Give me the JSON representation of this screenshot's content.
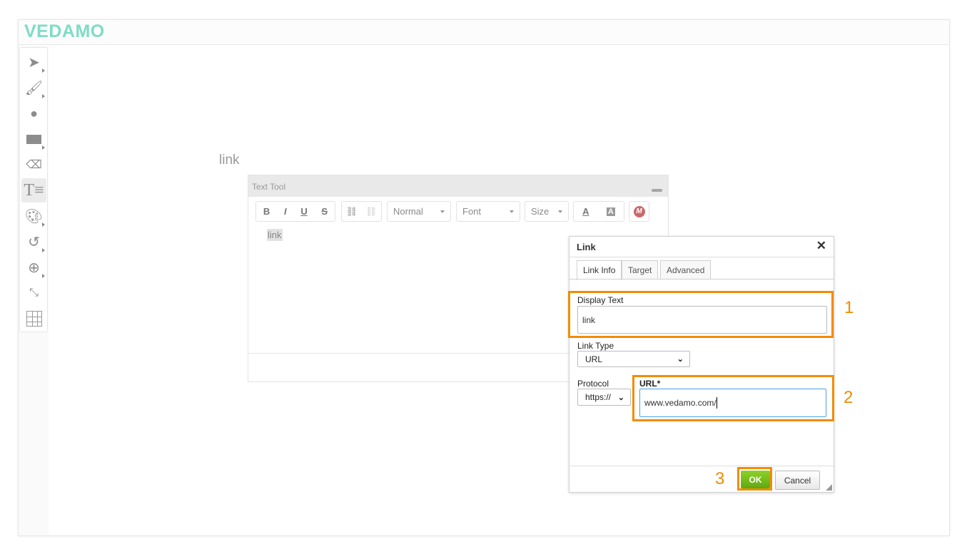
{
  "app": {
    "logo": "VEDAMO"
  },
  "toolbar": {
    "tools": [
      {
        "name": "select",
        "icon": "cursor-arrow-icon"
      },
      {
        "name": "brush",
        "icon": "brush-icon"
      },
      {
        "name": "presenter",
        "icon": "presenter-icon"
      },
      {
        "name": "shape",
        "icon": "rectangle-icon"
      },
      {
        "name": "eraser",
        "icon": "eraser-icon"
      },
      {
        "name": "text",
        "icon": "text-tool-icon",
        "active": true
      },
      {
        "name": "color",
        "icon": "palette-icon"
      },
      {
        "name": "undo",
        "icon": "undo-icon"
      },
      {
        "name": "zoom",
        "icon": "zoom-in-icon"
      },
      {
        "name": "fit",
        "icon": "collapse-icon"
      },
      {
        "name": "grid",
        "icon": "grid-icon"
      }
    ]
  },
  "canvas": {
    "text": "link"
  },
  "text_tool": {
    "title": "Text Tool",
    "buttons": {
      "bold": "B",
      "italic": "I",
      "underline": "U",
      "strike": "S",
      "font_color": "A",
      "bg_color": "A"
    },
    "format": "Normal",
    "font": "Font",
    "size": "Size",
    "content": "link",
    "accent": "#c96a6a"
  },
  "link_dialog": {
    "title": "Link",
    "tabs": [
      "Link Info",
      "Target",
      "Advanced"
    ],
    "display_text_label": "Display Text",
    "display_text_value": "link",
    "link_type_label": "Link Type",
    "link_type_value": "URL",
    "protocol_label": "Protocol",
    "protocol_value": "https://",
    "url_label": "URL*",
    "url_value": "www.vedamo.com/",
    "ok": "OK",
    "cancel": "Cancel"
  },
  "annotations": {
    "steps": [
      "1",
      "2",
      "3"
    ],
    "color": "#f28c00"
  }
}
